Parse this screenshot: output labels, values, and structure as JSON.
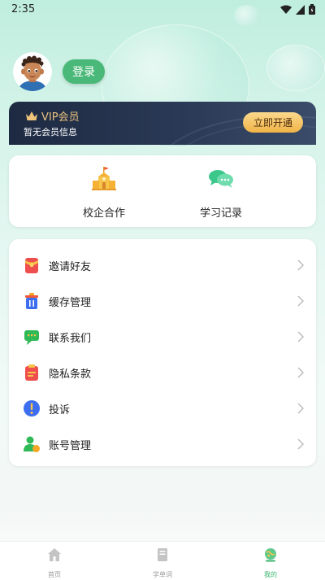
{
  "status_bar": {
    "time": "2:35"
  },
  "profile": {
    "login_label": "登录"
  },
  "vip": {
    "title": "VIP会员",
    "subtitle": "暂无会员信息",
    "button_label": "立即开通"
  },
  "quick_actions": [
    {
      "label": "校企合作",
      "icon": "school-building-icon"
    },
    {
      "label": "学习记录",
      "icon": "chat-bubbles-icon"
    }
  ],
  "menu": [
    {
      "label": "邀请好友",
      "icon": "red-envelope-icon",
      "color": "#ef4e4e"
    },
    {
      "label": "缓存管理",
      "icon": "trash-bin-icon",
      "color": "#3d6ef0"
    },
    {
      "label": "联系我们",
      "icon": "message-icon",
      "color": "#2fb957"
    },
    {
      "label": "隐私条款",
      "icon": "clipboard-icon",
      "color": "#ef4e4e"
    },
    {
      "label": "投诉",
      "icon": "exclamation-icon",
      "color": "#3d6ef0"
    },
    {
      "label": "账号管理",
      "icon": "user-account-icon",
      "color": "#2fb957"
    }
  ],
  "bottom_nav": [
    {
      "label": "首页",
      "icon": "home-icon",
      "active": false
    },
    {
      "label": "学单词",
      "icon": "book-icon",
      "active": false
    },
    {
      "label": "我的",
      "icon": "profile-globe-icon",
      "active": true
    }
  ],
  "colors": {
    "accent": "#4ab878",
    "vip_gold": "#e9c27e",
    "vip_bg": "#1e2a42"
  }
}
